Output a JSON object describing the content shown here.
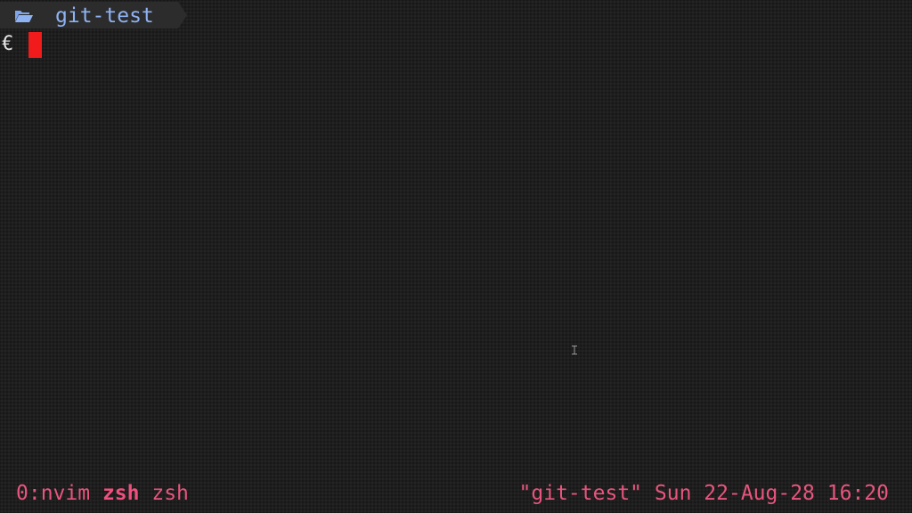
{
  "prompt": {
    "icon": "folder-open-icon",
    "path": "git-test",
    "symbol": "€"
  },
  "status_bar": {
    "windows": [
      {
        "label": "0:nvim",
        "active": false
      },
      {
        "label": "zsh",
        "active": true
      },
      {
        "label": "zsh",
        "active": false
      }
    ],
    "session_title": "\"git-test\"",
    "datetime": "Sun 22-Aug-28 16:20"
  },
  "colors": {
    "path": "#8fb2f2",
    "cursor": "#f21b1b",
    "status": "#e8557e",
    "background": "#1e1e1e"
  }
}
